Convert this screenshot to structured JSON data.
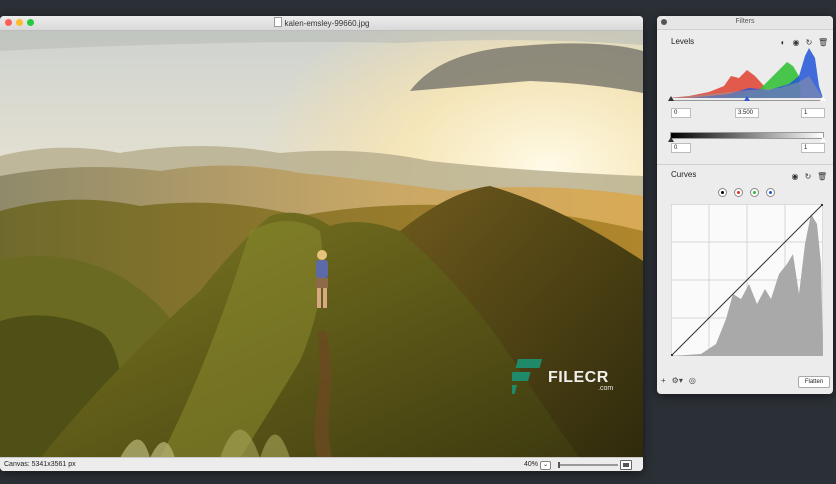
{
  "window": {
    "title": "kalen-emsley-99660.jpg",
    "status_canvas": "Canvas: 5341x3561 px",
    "zoom": "40%",
    "zoom_fraction": 0.04
  },
  "watermark": {
    "brand": "FILECR",
    "suffix": ".com"
  },
  "filters_panel": {
    "title": "Filters",
    "levels": {
      "label": "Levels",
      "black_input": "0",
      "gamma_input": "3.500",
      "white_input": "1",
      "output_black": "0",
      "output_white": "1"
    },
    "curves": {
      "label": "Curves",
      "channels": [
        "black",
        "red",
        "green",
        "blue"
      ]
    },
    "footer": {
      "add_icon": "plus-icon",
      "gear_icon": "gear-icon",
      "preview_icon": "eye-icon",
      "flatten_label": "Flatten"
    }
  },
  "colors": {
    "background": "#2b3036",
    "hist_red": "#e04a3a",
    "hist_green": "#35c23a",
    "hist_blue": "#2255d8",
    "curve_fill": "#a9a9a9"
  }
}
